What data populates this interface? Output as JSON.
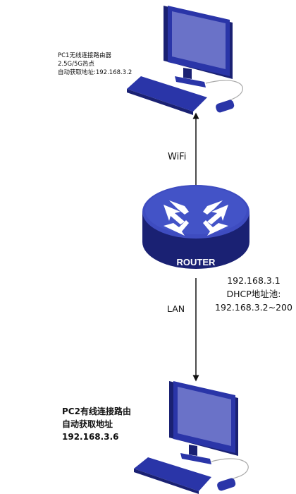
{
  "pc1": {
    "lines": [
      "PC1无线连接路由器",
      "2.5G/5G热点",
      "自动获取地址:192.168.3.2"
    ]
  },
  "pc2": {
    "lines": [
      "PC2有线连接路由",
      "自动获取地址",
      "192.168.3.6"
    ]
  },
  "router": {
    "name": "ROUTER",
    "info_lines": [
      "192.168.3.1",
      "DHCP地址池:",
      "192.168.3.2~200"
    ]
  },
  "links": {
    "wifi_label": "WiFi",
    "lan_label": "LAN"
  },
  "colors": {
    "device_blue": "#2a35a8",
    "device_dark": "#1a2173",
    "screen": "#6a72c8",
    "router_light": "#3e4cc0"
  },
  "icons": [
    "monitor-icon",
    "keyboard-icon",
    "mouse-icon",
    "router-icon"
  ]
}
